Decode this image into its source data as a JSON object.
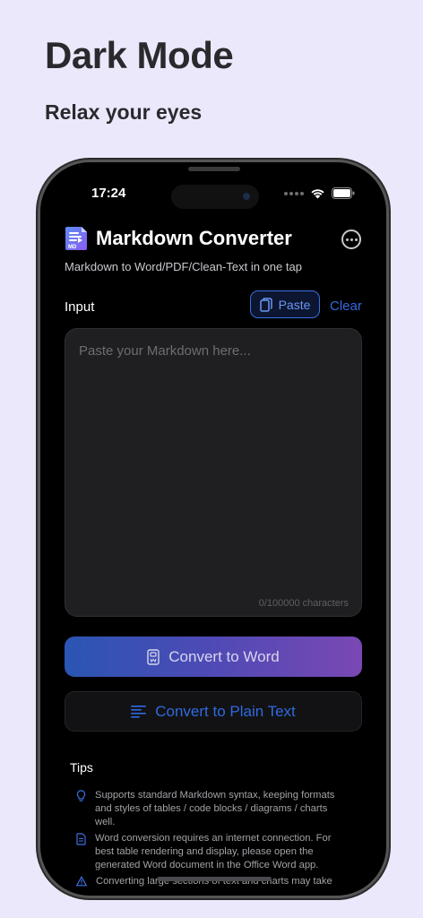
{
  "promo": {
    "headline": "Dark Mode",
    "subheadline": "Relax your eyes"
  },
  "status_bar": {
    "time": "17:24"
  },
  "app": {
    "title": "Markdown Converter",
    "subtitle": "Markdown to Word/PDF/Clean-Text in one tap",
    "logo_text": "MD"
  },
  "input": {
    "label": "Input",
    "paste_label": "Paste",
    "clear_label": "Clear",
    "placeholder": "Paste your Markdown here...",
    "char_count": "0/100000 characters"
  },
  "actions": {
    "convert_word": "Convert to Word",
    "convert_plain": "Convert to Plain Text"
  },
  "tips": {
    "title": "Tips",
    "items": [
      "Supports standard Markdown syntax, keeping formats and styles of tables / code blocks / diagrams / charts well.",
      "Word conversion requires an internet connection. For best table rendering and display, please open the generated Word document in the Office Word app.",
      "Converting large sections of text and charts may take"
    ]
  },
  "colors": {
    "accent": "#2f6adf",
    "background": "#ECE8FB",
    "screen": "#000000"
  }
}
